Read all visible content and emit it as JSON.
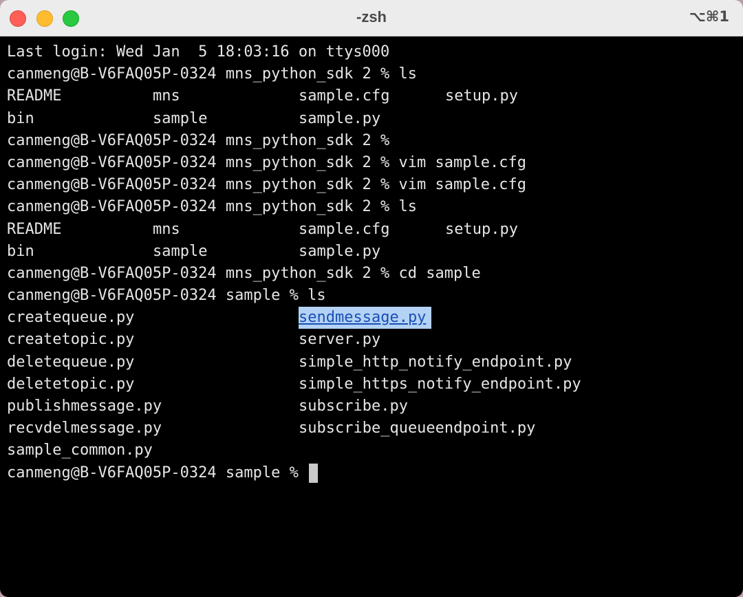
{
  "window": {
    "title": "-zsh",
    "shortcut": "⌥⌘1"
  },
  "terminal": {
    "login_line": "Last login: Wed Jan  5 18:03:16 on ttys000",
    "prompts": [
      "canmeng@B-V6FAQ05P-0324 mns_python_sdk 2 % ls",
      "canmeng@B-V6FAQ05P-0324 mns_python_sdk 2 %",
      "canmeng@B-V6FAQ05P-0324 mns_python_sdk 2 % vim sample.cfg",
      "canmeng@B-V6FAQ05P-0324 mns_python_sdk 2 % vim sample.cfg",
      "canmeng@B-V6FAQ05P-0324 mns_python_sdk 2 % ls",
      "canmeng@B-V6FAQ05P-0324 mns_python_sdk 2 % cd sample",
      "canmeng@B-V6FAQ05P-0324 sample % ls",
      "canmeng@B-V6FAQ05P-0324 sample % "
    ],
    "ls_root": [
      [
        "README",
        "mns",
        "sample.cfg",
        "setup.py"
      ],
      [
        "bin",
        "sample",
        "sample.py"
      ]
    ],
    "ls_sample_left": [
      "createqueue.py",
      "createtopic.py",
      "deletequeue.py",
      "deletetopic.py",
      "publishmessage.py",
      "recvdelmessage.py",
      "sample_common.py"
    ],
    "ls_sample_right": [
      "sendmessage.py",
      "server.py",
      "simple_http_notify_endpoint.py",
      "simple_https_notify_endpoint.py",
      "subscribe.py",
      "subscribe_queueendpoint.py"
    ],
    "selected_file": "sendmessage.py"
  },
  "colors": {
    "background": "#000000",
    "text": "#e6e6e6",
    "selection": "#b3d2f4",
    "selection_text": "#1a4fb5",
    "close": "#fe5f57",
    "minimize": "#febc2e",
    "zoom": "#28c840"
  }
}
